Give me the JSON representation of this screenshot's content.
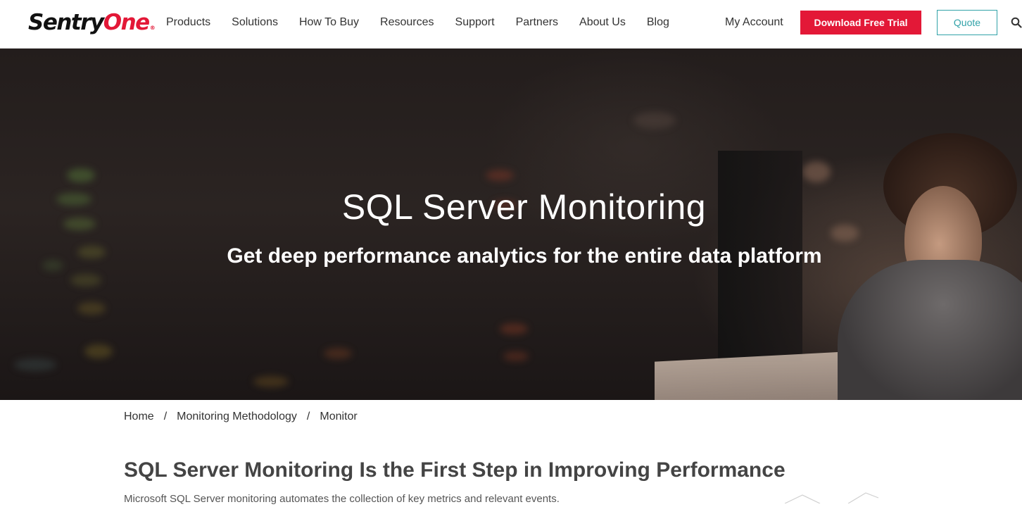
{
  "brand": {
    "name_part1": "Sentry",
    "name_part2": "One",
    "registered_mark": "®"
  },
  "nav": {
    "items": [
      {
        "label": "Products"
      },
      {
        "label": "Solutions"
      },
      {
        "label": "How To Buy"
      },
      {
        "label": "Resources"
      },
      {
        "label": "Support"
      },
      {
        "label": "Partners"
      },
      {
        "label": "About Us"
      },
      {
        "label": "Blog"
      }
    ],
    "my_account": "My Account",
    "trial_button": "Download Free Trial",
    "quote_button": "Quote",
    "search_icon": "search-icon"
  },
  "hero": {
    "title": "SQL Server Monitoring",
    "subtitle": "Get deep performance analytics for the entire data platform"
  },
  "breadcrumb": {
    "items": [
      "Home",
      "Monitoring Methodology",
      "Monitor"
    ],
    "separator": "/"
  },
  "content": {
    "heading": "SQL Server Monitoring Is the First Step in Improving Performance",
    "intro": "Microsoft SQL Server monitoring automates the collection of key metrics and relevant events."
  },
  "colors": {
    "accent_red": "#e31837",
    "accent_teal": "#31a2a8"
  }
}
